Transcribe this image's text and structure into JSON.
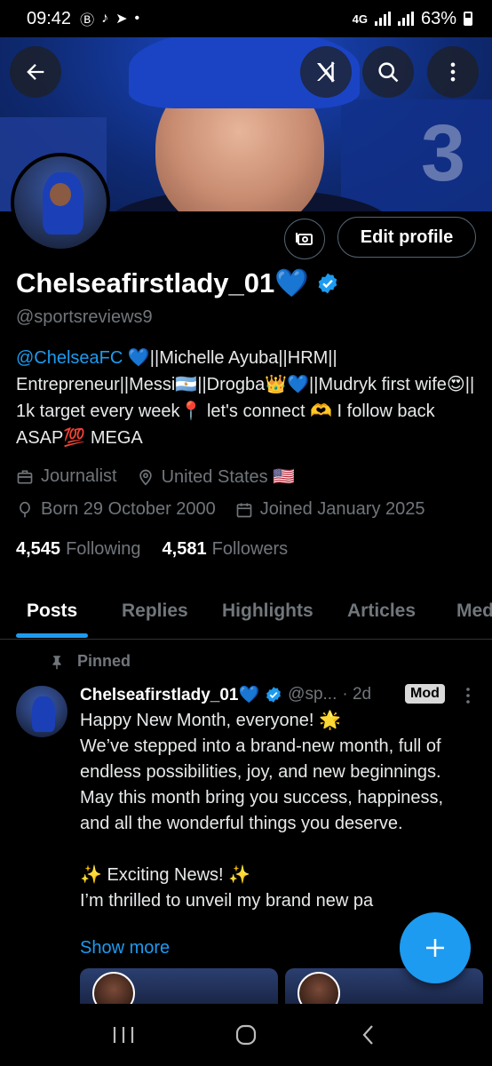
{
  "status_bar": {
    "time": "09:42",
    "network": "4G",
    "battery": "63%"
  },
  "profile": {
    "display_name": "Chelseafirstlady_01💙",
    "handle": "@sportsreviews9",
    "edit_profile_label": "Edit profile",
    "bio_mention": "@ChelseaFC",
    "bio_text": " 💙||Michelle Ayuba||HRM|| Entrepreneur||Messi🇦🇷||Drogba👑💙||Mudryk first wife😍|| 1k target every week📍 let's connect 🫶 I follow back ASAP💯 MEGA",
    "category": "Journalist",
    "location": "United States 🇺🇸",
    "birthday": "Born 29 October 2000",
    "joined": "Joined January 2025",
    "following_count": "4,545",
    "following_label": "Following",
    "followers_count": "4,581",
    "followers_label": "Followers"
  },
  "tabs": [
    {
      "label": "Posts",
      "active": true
    },
    {
      "label": "Replies",
      "active": false
    },
    {
      "label": "Highlights",
      "active": false
    },
    {
      "label": "Articles",
      "active": false
    },
    {
      "label": "Med",
      "active": false
    }
  ],
  "pinned_post": {
    "pinned_label": "Pinned",
    "author_name": "Chelseafirstlady_01💙",
    "author_handle": "@sp...",
    "time_ago": "· 2d",
    "badge": "Mod",
    "text": "Happy New Month, everyone! 🌟\nWe’ve stepped into a brand-new month, full of endless possibilities, joy, and new beginnings. May this month bring you success, happiness, and all the wonderful things you deserve.\n\n✨ Exciting News! ✨\nI’m thrilled to unveil my brand new pa",
    "show_more_label": "Show more"
  },
  "colors": {
    "accent": "#1d9bf0",
    "background": "#000000",
    "muted_text": "#71767b",
    "border": "#2f3336"
  },
  "icons": {
    "back": "arrow-left-icon",
    "grok": "grok-icon",
    "search": "search-icon",
    "more": "more-vertical-icon",
    "verified": "verified-badge-icon",
    "job": "briefcase-icon",
    "location": "location-pin-icon",
    "birthday": "balloon-icon",
    "calendar": "calendar-icon",
    "pin": "pin-icon",
    "compose": "plus-icon",
    "tip": "money-icon"
  }
}
